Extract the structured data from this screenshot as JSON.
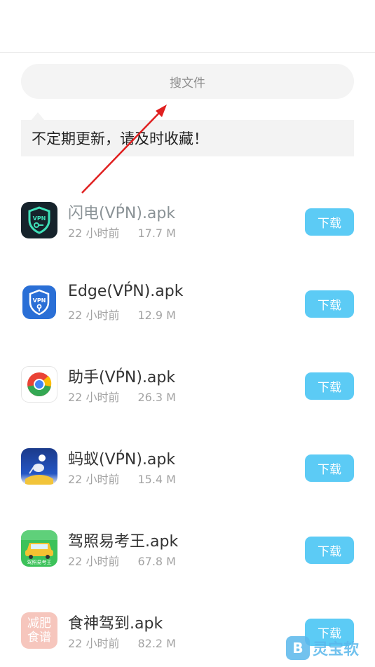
{
  "search": {
    "placeholder": "搜文件"
  },
  "notice": {
    "text": "不定期更新，请及时收藏！"
  },
  "files": [
    {
      "name": "闪电(VṔN).apk",
      "time": "22 小时前",
      "size": "17.7 M",
      "icon": "vpn-shield-icon",
      "download_label": "下载"
    },
    {
      "name": "Edge(VṔN).apk",
      "time": "22 小时前",
      "size": "12.9 M",
      "icon": "vpn-blue-shield-icon",
      "download_label": "下载"
    },
    {
      "name": "助手(VṔN).apk",
      "time": "22 小时前",
      "size": "26.3 M",
      "icon": "chrome-icon",
      "download_label": "下载"
    },
    {
      "name": "蚂蚁(VṔN).apk",
      "time": "22 小时前",
      "size": "15.4 M",
      "icon": "ant-icon",
      "download_label": "下载"
    },
    {
      "name": "驾照易考王.apk",
      "time": "22 小时前",
      "size": "67.8 M",
      "icon": "car-icon",
      "download_label": "下载",
      "icon_text": "驾照易考王"
    },
    {
      "name": "食神驾到.apk",
      "time": "22 小时前",
      "size": "82.2 M",
      "icon": "diet-recipe-icon",
      "download_label": "下载",
      "icon_text": "减肥食谱"
    }
  ],
  "watermark": {
    "logo": "B",
    "text": "灵宝软"
  },
  "colors": {
    "accent": "#5ccbf5",
    "arrow": "#e02020"
  }
}
